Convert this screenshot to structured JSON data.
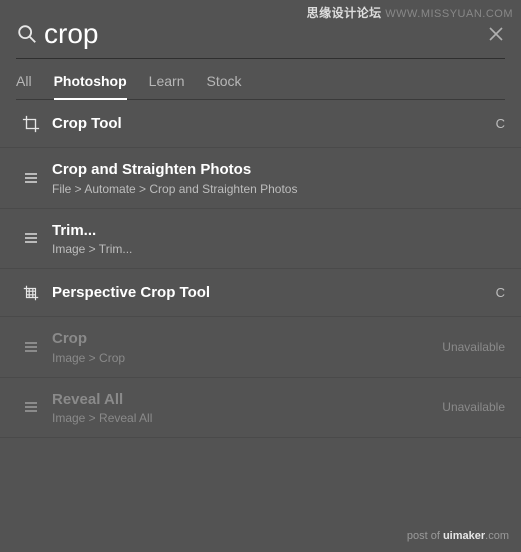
{
  "watermarks": {
    "top_left": "思缘设计论坛",
    "top_right": "WWW.MISSYUAN.COM",
    "bottom_prefix": "post of ",
    "bottom_bold": "uimaker",
    "bottom_suffix": ".com"
  },
  "search": {
    "value": "crop",
    "placeholder": "Search"
  },
  "tabs": [
    {
      "label": "All",
      "active": false
    },
    {
      "label": "Photoshop",
      "active": true
    },
    {
      "label": "Learn",
      "active": false
    },
    {
      "label": "Stock",
      "active": false
    }
  ],
  "results": [
    {
      "icon": "crop",
      "title": "Crop Tool",
      "sub": "",
      "shortcut": "C",
      "status": ""
    },
    {
      "icon": "menu",
      "title": "Crop and Straighten Photos",
      "sub": "File > Automate > Crop and Straighten Photos",
      "shortcut": "",
      "status": ""
    },
    {
      "icon": "menu",
      "title": "Trim...",
      "sub": "Image > Trim...",
      "shortcut": "",
      "status": ""
    },
    {
      "icon": "perspective",
      "title": "Perspective Crop Tool",
      "sub": "",
      "shortcut": "C",
      "status": ""
    },
    {
      "icon": "menu",
      "title": "Crop",
      "sub": "Image > Crop",
      "shortcut": "",
      "status": "Unavailable"
    },
    {
      "icon": "menu",
      "title": "Reveal All",
      "sub": "Image > Reveal All",
      "shortcut": "",
      "status": "Unavailable"
    }
  ]
}
